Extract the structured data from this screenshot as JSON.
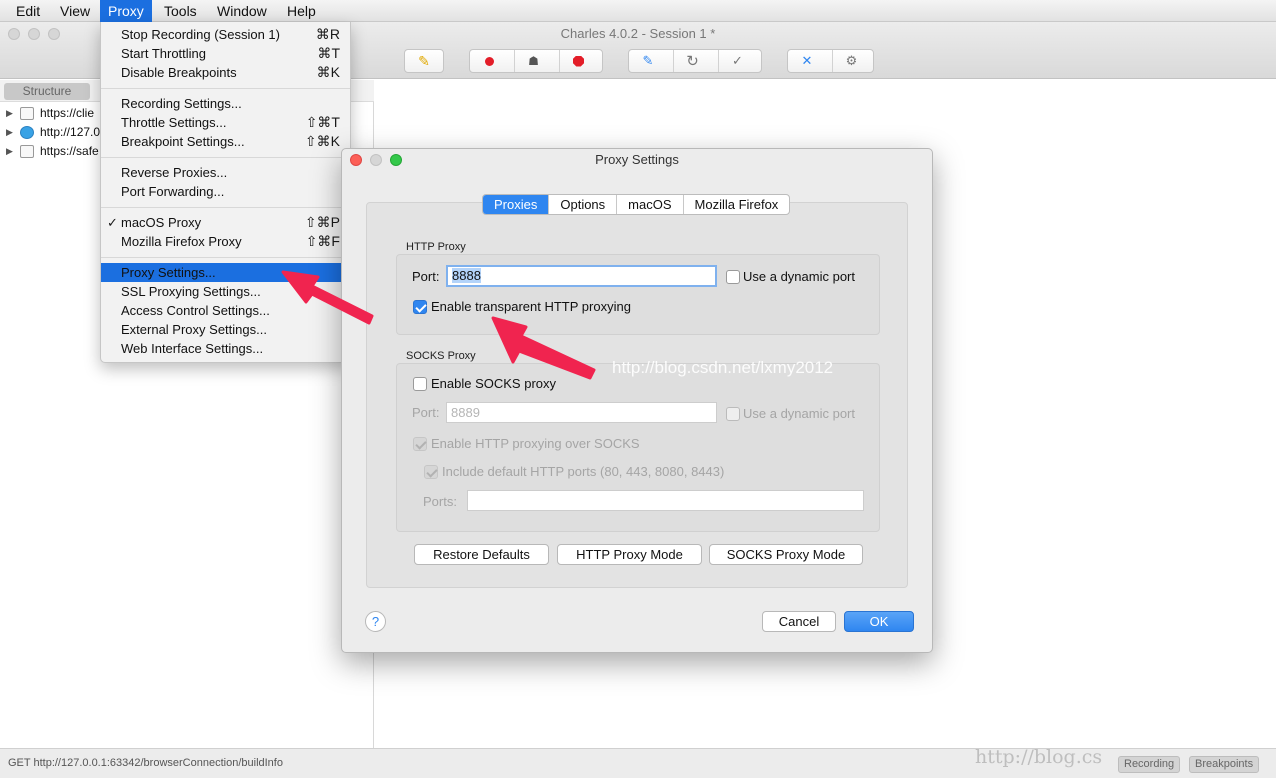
{
  "menubar": {
    "items": [
      "Edit",
      "View",
      "Proxy",
      "Tools",
      "Window",
      "Help"
    ]
  },
  "window": {
    "title": "Charles 4.0.2 - Session 1 *"
  },
  "sidebar": {
    "tab": "Structure",
    "tree": [
      "https://clie",
      "http://127.0",
      "https://safe"
    ]
  },
  "proxy_menu": {
    "stop_recording": {
      "label": "Stop Recording (Session 1)",
      "shortcut": "⌘R"
    },
    "start_throttling": {
      "label": "Start Throttling",
      "shortcut": "⌘T"
    },
    "disable_breakpoints": {
      "label": "Disable Breakpoints",
      "shortcut": "⌘K"
    },
    "recording_settings": {
      "label": "Recording Settings..."
    },
    "throttle_settings": {
      "label": "Throttle Settings...",
      "shortcut": "⇧⌘T"
    },
    "breakpoint_settings": {
      "label": "Breakpoint Settings...",
      "shortcut": "⇧⌘K"
    },
    "reverse_proxies": {
      "label": "Reverse Proxies..."
    },
    "port_forwarding": {
      "label": "Port Forwarding..."
    },
    "macos_proxy": {
      "label": "macOS Proxy",
      "shortcut": "⇧⌘P",
      "check": "✓"
    },
    "firefox_proxy": {
      "label": "Mozilla Firefox Proxy",
      "shortcut": "⇧⌘F"
    },
    "proxy_settings": {
      "label": "Proxy Settings..."
    },
    "ssl_proxying": {
      "label": "SSL Proxying Settings..."
    },
    "access_control": {
      "label": "Access Control Settings..."
    },
    "external_proxy": {
      "label": "External Proxy Settings..."
    },
    "web_interface": {
      "label": "Web Interface Settings..."
    }
  },
  "dialog": {
    "title": "Proxy Settings",
    "tabs": [
      "Proxies",
      "Options",
      "macOS",
      "Mozilla Firefox"
    ],
    "http_proxy": {
      "title": "HTTP Proxy",
      "port_label": "Port:",
      "port_value": "8888",
      "dynamic_port": "Use a dynamic port",
      "transparent": "Enable transparent HTTP proxying"
    },
    "socks_proxy": {
      "title": "SOCKS Proxy",
      "enable": "Enable SOCKS proxy",
      "port_label": "Port:",
      "port_placeholder": "8889",
      "dynamic_port": "Use a dynamic port",
      "http_over_socks": "Enable HTTP proxying over SOCKS",
      "default_ports": "Include default HTTP ports (80, 443, 8080, 8443)",
      "ports_label": "Ports:"
    },
    "buttons": {
      "restore": "Restore Defaults",
      "http_mode": "HTTP Proxy Mode",
      "socks_mode": "SOCKS Proxy Mode",
      "help": "?",
      "cancel": "Cancel",
      "ok": "OK"
    }
  },
  "status": {
    "text": "GET http://127.0.0.1:63342/browserConnection/buildInfo",
    "recording": "Recording",
    "breakpoints": "Breakpoints"
  },
  "watermarks": {
    "center": "http://blog.csdn.net/lxmy2012",
    "corner": "http://blog.cs"
  },
  "colors": {
    "accent": "#2f86f0",
    "menu_highlight": "#1b6fe0",
    "annotation_arrow": "#f0244f"
  }
}
